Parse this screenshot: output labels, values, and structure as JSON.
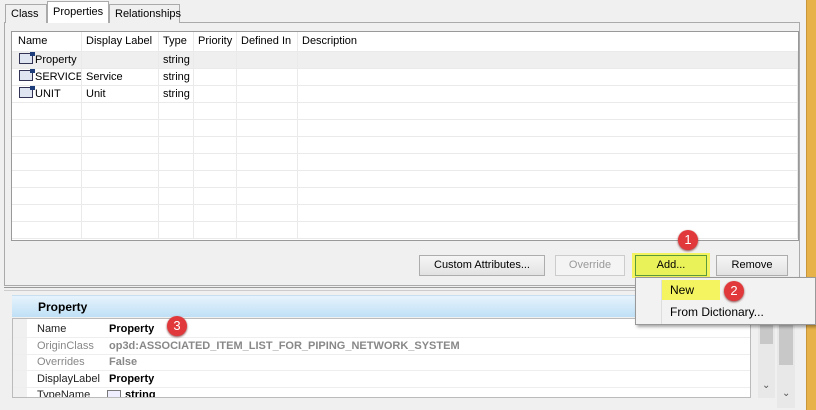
{
  "tabs": [
    "Class",
    "Properties",
    "Relationships"
  ],
  "table": {
    "columns": [
      "Name",
      "Display Label",
      "Type",
      "Priority",
      "Defined In",
      "Description"
    ],
    "rows": [
      {
        "name": "Property",
        "display_label": "",
        "type": "string"
      },
      {
        "name": "SERVICE",
        "display_label": "Service",
        "type": "string"
      },
      {
        "name": "UNIT",
        "display_label": "Unit",
        "type": "string"
      }
    ]
  },
  "buttons": {
    "custom_attributes": "Custom Attributes...",
    "override": "Override",
    "add": "Add...",
    "remove": "Remove"
  },
  "add_menu": {
    "items": [
      "New",
      "From Dictionary..."
    ]
  },
  "badges": [
    "1",
    "2",
    "3"
  ],
  "property_panel": {
    "title": "Property",
    "rows": [
      {
        "label": "Name",
        "value": "Property"
      },
      {
        "label": "OriginClass",
        "value": "op3d:ASSOCIATED_ITEM_LIST_FOR_PIPING_NETWORK_SYSTEM"
      },
      {
        "label": "Overrides",
        "value": "False"
      },
      {
        "label": "DisplayLabel",
        "value": "Property"
      },
      {
        "label": "TypeName",
        "value": "string"
      }
    ]
  },
  "colors": {
    "highlight": "#f4f460",
    "badge": "#e0383b",
    "accent_strip": "#e8b24a"
  }
}
